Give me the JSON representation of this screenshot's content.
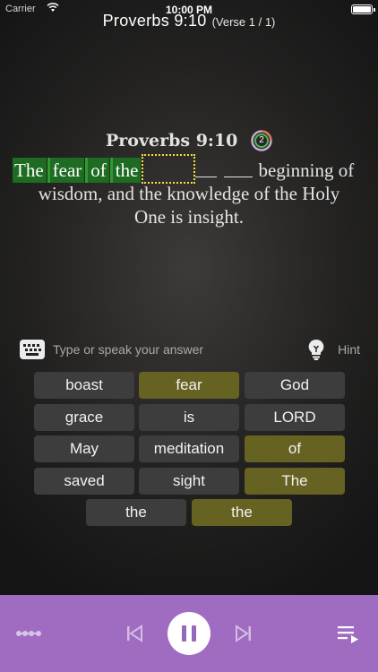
{
  "status_bar": {
    "carrier": "Carrier",
    "time": "10:00 PM"
  },
  "header": {
    "title": "Proverbs 9:10",
    "verse_count": "(Verse 1 / 1)"
  },
  "verse": {
    "reference": "Proverbs 9:10",
    "progress_number": "2",
    "revealed_words": [
      "The",
      "fear",
      "of",
      "the"
    ],
    "line1_tail": "beginning of",
    "line2": "wisdom, and the knowledge of the Holy",
    "line3": "One is insight."
  },
  "input": {
    "placeholder": "Type or speak your answer",
    "hint_label": "Hint"
  },
  "word_bank": [
    {
      "word": "boast",
      "used": false
    },
    {
      "word": "fear",
      "used": true
    },
    {
      "word": "God",
      "used": false
    },
    {
      "word": "grace",
      "used": false
    },
    {
      "word": "is",
      "used": false
    },
    {
      "word": "LORD",
      "used": false
    },
    {
      "word": "May",
      "used": false
    },
    {
      "word": "meditation",
      "used": false
    },
    {
      "word": "of",
      "used": true
    },
    {
      "word": "saved",
      "used": false
    },
    {
      "word": "sight",
      "used": false
    },
    {
      "word": "The",
      "used": true
    },
    {
      "word": "the",
      "used": false
    },
    {
      "word": "the",
      "used": true
    }
  ],
  "colors": {
    "revealed_word_bg": "#1e6b22",
    "chip_default_bg": "#3d3d3d",
    "chip_used_bg": "#666222",
    "current_slot_outline": "#f4e13a",
    "player_bar_bg": "#a06cc2"
  },
  "player": {
    "icons": [
      "progress-dots-icon",
      "skip-previous-icon",
      "pause-icon",
      "skip-next-icon",
      "playlist-icon"
    ]
  }
}
